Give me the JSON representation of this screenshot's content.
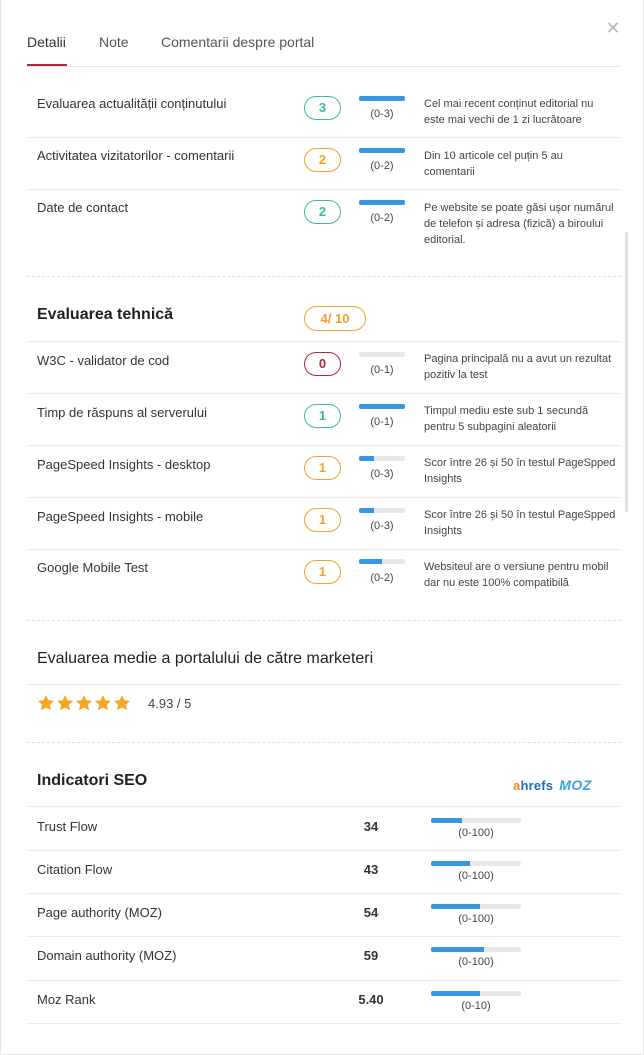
{
  "colors": {
    "accent": "#b0253b",
    "teal": "#3fb8a2",
    "orange": "#f2a12e",
    "bar": "#3497e0",
    "star": "#f5a623"
  },
  "tabs": [
    {
      "label": "Detalii"
    },
    {
      "label": "Note"
    },
    {
      "label": "Comentarii despre portal"
    }
  ],
  "content_rows": [
    {
      "label": "Evaluarea actualității conținutului",
      "score": "3",
      "range": "(0-3)",
      "fill": 1.0,
      "desc": "Cel mai recent conținut editorial nu este mai vechi de 1 zi lucrătoare"
    },
    {
      "label": "Activitatea vizitatorilor - comentarii",
      "score": "2",
      "range": "(0-2)",
      "fill": 1.0,
      "desc": "Din 10 articole cel puțin 5 au comentarii"
    },
    {
      "label": "Date de contact",
      "score": "2",
      "range": "(0-2)",
      "fill": 1.0,
      "desc": "Pe website se poate găsi ușor numărul de telefon și adresa (fizică) a biroului editorial."
    }
  ],
  "technical": {
    "title": "Evaluarea tehnică",
    "score": "4/ 10",
    "rows": [
      {
        "label": "W3C - validator de cod",
        "score": "0",
        "range": "(0-1)",
        "fill": 0.0,
        "desc": "Pagina principală nu a avut un rezultat pozitiv la test"
      },
      {
        "label": "Timp de răspuns al serverului",
        "score": "1",
        "range": "(0-1)",
        "fill": 1.0,
        "desc": "Timpul mediu este sub 1 secundă pentru 5 subpagini aleatorii"
      },
      {
        "label": "PageSpeed Insights - desktop",
        "score": "1",
        "range": "(0-3)",
        "fill": 0.33,
        "desc": "Scor între 26 și 50 în testul PageSpped Insights"
      },
      {
        "label": "PageSpeed Insights - mobile",
        "score": "1",
        "range": "(0-3)",
        "fill": 0.33,
        "desc": "Scor între 26 și 50 în testul PageSpped Insights"
      },
      {
        "label": "Google Mobile Test",
        "score": "1",
        "range": "(0-2)",
        "fill": 0.5,
        "desc": "Websiteul are o versiune pentru mobil dar nu este 100% compatibilă"
      }
    ]
  },
  "marketers": {
    "title": "Evaluarea medie a portalului de către marketeri",
    "rating": "4.93 / 5",
    "stars": 5
  },
  "seo": {
    "title": "Indicatori SEO",
    "logo_ahrefs_a": "a",
    "logo_ahrefs_rest": "hrefs",
    "logo_moz": "MOZ",
    "rows": [
      {
        "label": "Trust Flow",
        "value": "34",
        "range": "(0-100)",
        "fill": 0.34
      },
      {
        "label": "Citation Flow",
        "value": "43",
        "range": "(0-100)",
        "fill": 0.43
      },
      {
        "label": "Page authority (MOZ)",
        "value": "54",
        "range": "(0-100)",
        "fill": 0.54
      },
      {
        "label": "Domain authority (MOZ)",
        "value": "59",
        "range": "(0-100)",
        "fill": 0.59
      },
      {
        "label": "Moz Rank",
        "value": "5.40",
        "range": "(0-10)",
        "fill": 0.54
      }
    ]
  }
}
